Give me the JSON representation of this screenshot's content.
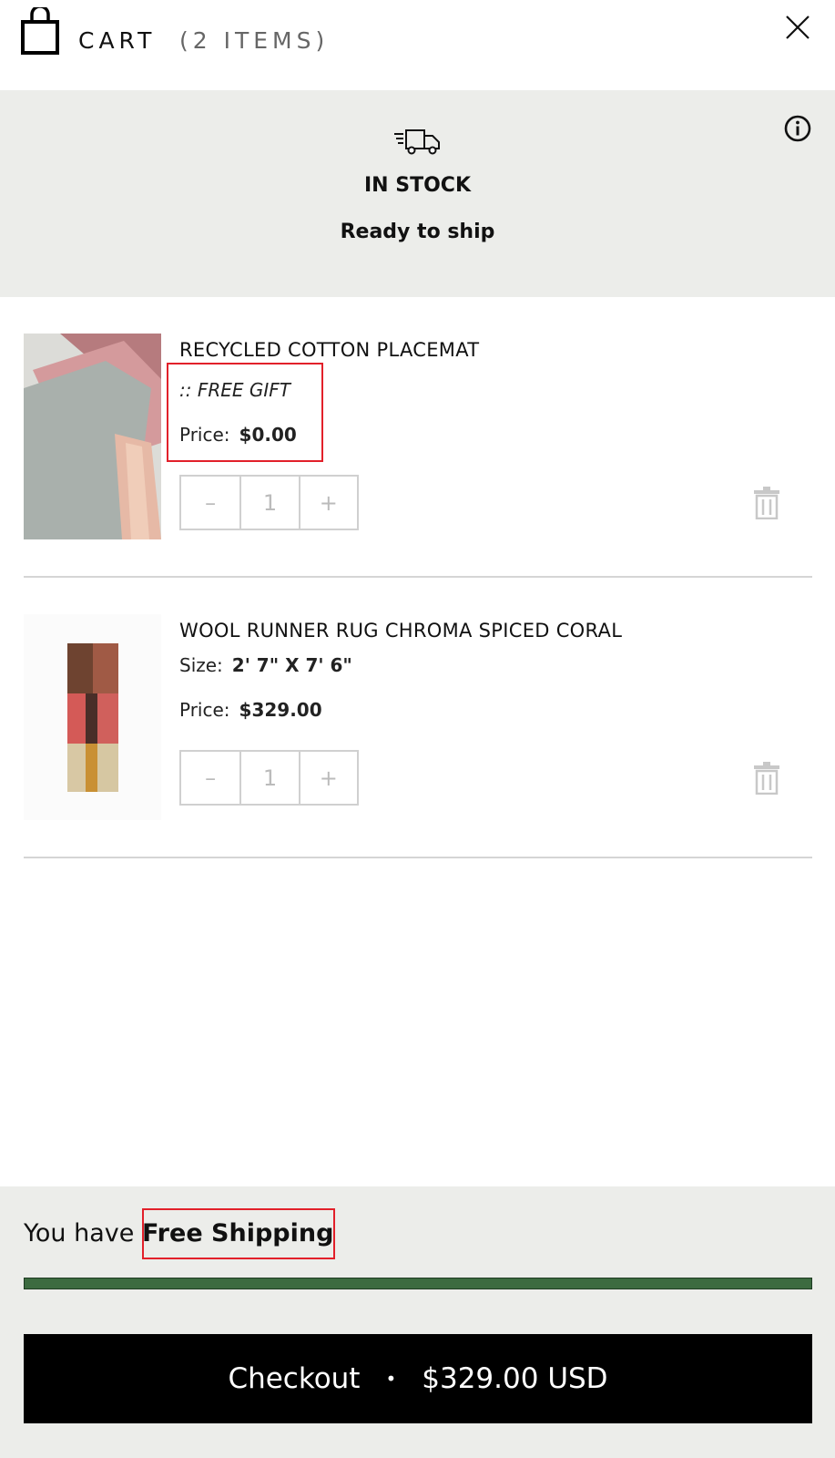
{
  "header": {
    "title": "CART",
    "count": "(2 ITEMS)"
  },
  "banner": {
    "title": "IN STOCK",
    "subtitle": "Ready to ship"
  },
  "items": [
    {
      "name": "RECYCLED COTTON PLACEMAT",
      "note": ":: FREE GIFT",
      "price_label": "Price:",
      "price": "$0.00",
      "qty_minus": "–",
      "quantity": "1",
      "qty_plus": "+"
    },
    {
      "name": "WOOL RUNNER RUG CHROMA SPICED CORAL",
      "size_label": "Size:",
      "size": "2' 7\" X 7' 6\"",
      "price_label": "Price:",
      "price": "$329.00",
      "qty_minus": "–",
      "quantity": "1",
      "qty_plus": "+"
    }
  ],
  "footer": {
    "shipping_prefix": "You have",
    "shipping_status": "Free Shipping",
    "progress_fraction": 1.0,
    "checkout_label": "Checkout",
    "checkout_separator": "•",
    "checkout_total": "$329.00 USD"
  },
  "colors": {
    "banner_bg": "#ecedea",
    "progress_fill": "#3c6b40",
    "checkout_bg": "#000000",
    "highlight_border": "#e2202a"
  },
  "icons": [
    "bag-icon",
    "close-icon",
    "truck-icon",
    "info-icon",
    "trash-icon"
  ]
}
